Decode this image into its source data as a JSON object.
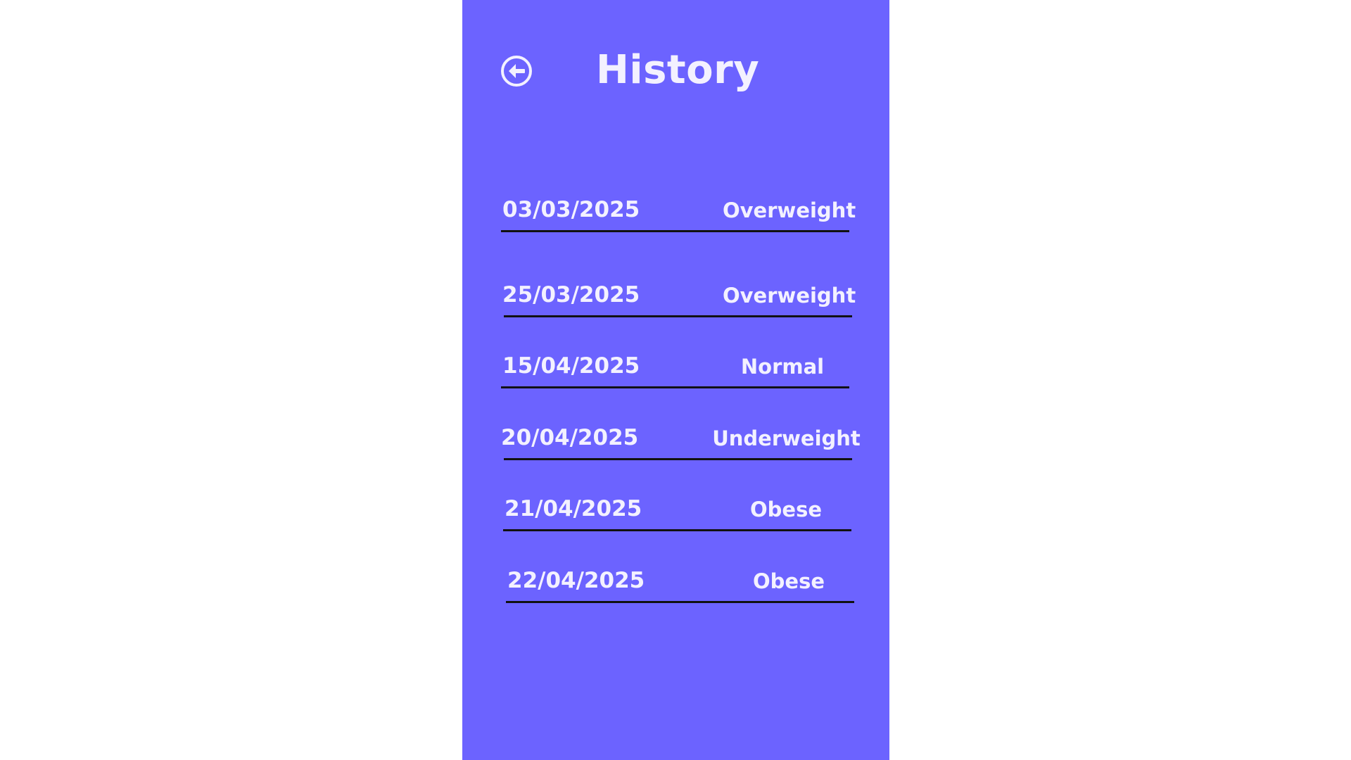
{
  "header": {
    "title": "History",
    "back_icon": "arrow-left-circle-icon"
  },
  "colors": {
    "panel_background": "#6C63FF",
    "page_background": "#FFFFFF",
    "text": "#F3F1FF",
    "divider": "#111111"
  },
  "history": [
    {
      "date": "03/03/2025",
      "status": "Overweight"
    },
    {
      "date": "25/03/2025",
      "status": "Overweight"
    },
    {
      "date": "15/04/2025",
      "status": "Normal"
    },
    {
      "date": "20/04/2025",
      "status": "Underweight"
    },
    {
      "date": "21/04/2025",
      "status": "Obese"
    },
    {
      "date": "22/04/2025",
      "status": "Obese"
    }
  ]
}
